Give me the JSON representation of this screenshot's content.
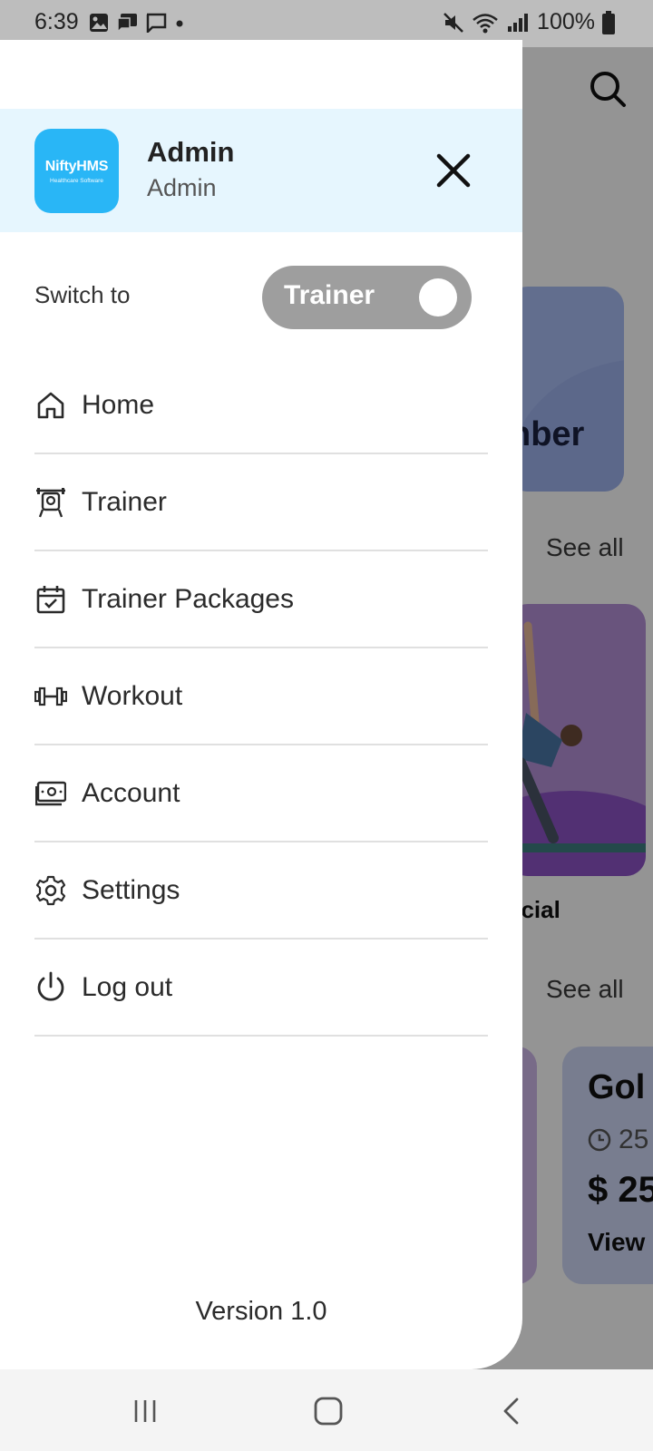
{
  "status_bar": {
    "time": "6:39",
    "battery": "100%"
  },
  "drawer": {
    "profile": {
      "logo_text": "NiftyHMS",
      "logo_subtext": "Healthcare Software",
      "name": "Admin",
      "role": "Admin"
    },
    "switch": {
      "label": "Switch to",
      "value": "Trainer"
    },
    "menu": [
      {
        "label": "Home",
        "icon": "home-icon"
      },
      {
        "label": "Trainer",
        "icon": "trainer-icon"
      },
      {
        "label": "Trainer Packages",
        "icon": "calendar-check-icon"
      },
      {
        "label": "Workout",
        "icon": "dumbbell-icon"
      },
      {
        "label": "Account",
        "icon": "money-icon"
      },
      {
        "label": "Settings",
        "icon": "gear-icon"
      },
      {
        "label": "Log out",
        "icon": "power-icon"
      }
    ],
    "version": "Version 1.0"
  },
  "background": {
    "member_card_text": "nber",
    "see_all_1": "See all",
    "see_all_2": "See all",
    "special_text": "ecial",
    "gold_card": {
      "title": "Gol",
      "duration": "25",
      "price": "$ 25",
      "view": "View"
    }
  },
  "colors": {
    "profile_bg": "#e6f6fe",
    "logo_bg": "#29b6f6",
    "switch_bg": "#9e9e9e"
  }
}
